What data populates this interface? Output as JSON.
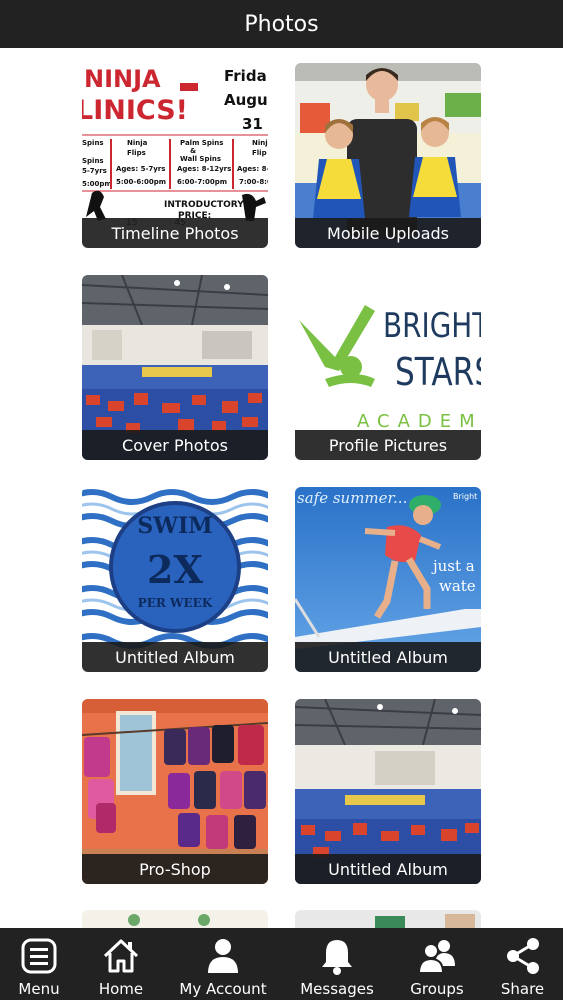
{
  "header": {
    "title": "Photos"
  },
  "albums": [
    {
      "label": "Timeline Photos"
    },
    {
      "label": "Mobile Uploads"
    },
    {
      "label": "Cover Photos"
    },
    {
      "label": "Profile Pictures"
    },
    {
      "label": "Untitled Album"
    },
    {
      "label": "Untitled Album"
    },
    {
      "label": "Pro-Shop"
    },
    {
      "label": "Untitled Album"
    }
  ],
  "thumbs": {
    "ninja": {
      "headline1": "NINJA",
      "headline2": "LINICS!",
      "date1": "Frida",
      "date2": "Augu",
      "date3": "31",
      "col1": [
        "Spins",
        "Spins",
        "5-7yrs",
        "5:00pm"
      ],
      "col2": [
        "Ninja",
        "Flips",
        "Ages: 5-7yrs",
        "5:00-6:00pm"
      ],
      "col3": [
        "Palm Spins",
        "&",
        "Wall Spins",
        "Ages: 8-12yrs",
        "6:00-7:00pm"
      ],
      "col4": [
        "Ninja",
        "Flip",
        "Ages: 8-",
        "7:00-8:0"
      ],
      "promo1": "INTRODUCTORY",
      "promo2": "PRICE:"
    },
    "logo": {
      "line1": "BRIGHT",
      "line2": "STARS",
      "line3": "ACADEMY"
    },
    "swim": {
      "line1": "SWIM",
      "line2": "2X",
      "line3": "PER WEEK"
    },
    "summer": {
      "top": "safe summer...",
      "right1": "just a",
      "right2": "wate",
      "brand": "Bright"
    }
  },
  "colors": {
    "bar": "#222222",
    "green": "#7ac143",
    "navy": "#1f3a5f",
    "pool": "#2b5fb3"
  },
  "tabs": [
    {
      "label": "Menu",
      "icon": "menu-icon"
    },
    {
      "label": "Home",
      "icon": "home-icon"
    },
    {
      "label": "My Account",
      "icon": "user-icon"
    },
    {
      "label": "Messages",
      "icon": "bell-icon"
    },
    {
      "label": "Groups",
      "icon": "group-icon"
    },
    {
      "label": "Share",
      "icon": "share-icon"
    }
  ]
}
